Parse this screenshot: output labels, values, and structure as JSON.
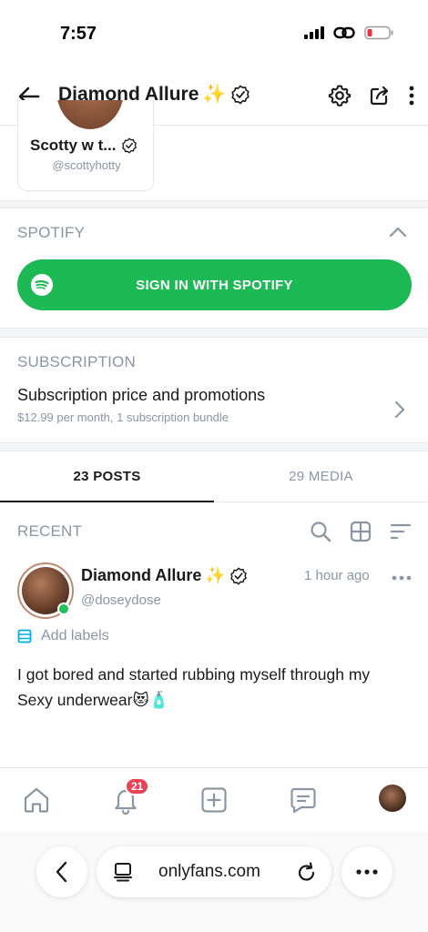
{
  "status": {
    "time": "7:57"
  },
  "header": {
    "title": "Diamond Allure",
    "title_emoji": "✨"
  },
  "suggested_user": {
    "name": "Scotty w t...",
    "handle": "@scottyhotty"
  },
  "spotify": {
    "section_label": "SPOTIFY",
    "button_label": "SIGN IN WITH SPOTIFY"
  },
  "subscription": {
    "section_label": "SUBSCRIPTION",
    "title": "Subscription price and promotions",
    "desc": "$12.99 per month, 1 subscription bundle"
  },
  "tabs": [
    {
      "label": "23 POSTS"
    },
    {
      "label": "29 MEDIA"
    }
  ],
  "recent": {
    "label": "RECENT"
  },
  "post": {
    "name": "Diamond Allure",
    "name_emoji": "✨",
    "handle": "@doseydose",
    "time": "1 hour ago",
    "add_labels": "Add labels",
    "text": "I got bored and started rubbing myself through my Sexy underwear😻🧴"
  },
  "nav": {
    "notifications_count": "21"
  },
  "browser": {
    "url": "onlyfans.com"
  },
  "colors": {
    "spotify_green": "#1db954",
    "badge_red": "#ee4257",
    "muted": "#8a96a3",
    "online": "#20c05c"
  }
}
